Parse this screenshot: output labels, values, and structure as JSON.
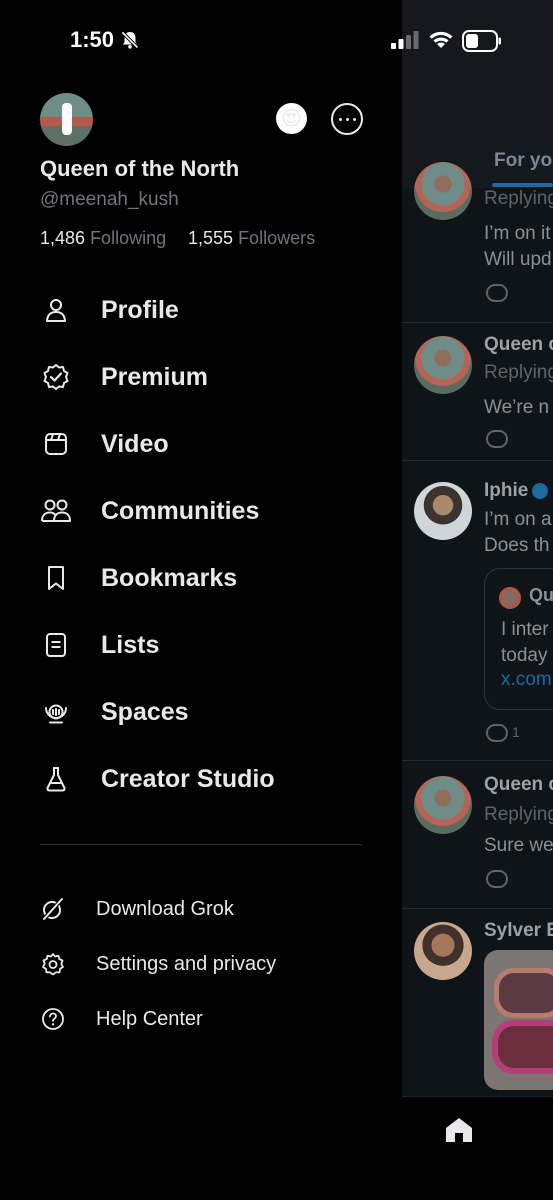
{
  "status_bar": {
    "time": "1:50",
    "icons": [
      "bell-slash-icon",
      "signal-icon",
      "wifi-icon",
      "battery-icon"
    ]
  },
  "profile": {
    "display_name": "Queen of the North",
    "handle": "@meenah_kush",
    "following_count": "1,486",
    "following_label": "Following",
    "followers_count": "1,555",
    "followers_label": "Followers",
    "emoji": "😍"
  },
  "menu": [
    {
      "label": "Profile",
      "icon": "person-icon"
    },
    {
      "label": "Premium",
      "icon": "verified-badge-icon"
    },
    {
      "label": "Video",
      "icon": "video-icon"
    },
    {
      "label": "Communities",
      "icon": "communities-icon"
    },
    {
      "label": "Bookmarks",
      "icon": "bookmark-icon"
    },
    {
      "label": "Lists",
      "icon": "list-icon"
    },
    {
      "label": "Spaces",
      "icon": "spaces-icon"
    },
    {
      "label": "Creator Studio",
      "icon": "flask-icon"
    }
  ],
  "secondary_menu": [
    {
      "label": "Download Grok",
      "icon": "grok-icon"
    },
    {
      "label": "Settings and privacy",
      "icon": "gear-icon"
    },
    {
      "label": "Help Center",
      "icon": "help-icon"
    }
  ],
  "timeline": {
    "tab": "For yo",
    "posts": [
      {
        "name": "",
        "sub": "Replying",
        "lines": [
          "I’m on it",
          "Will upd"
        ]
      },
      {
        "name": "Queen c",
        "sub": "Replying",
        "lines": [
          "We’re n"
        ]
      },
      {
        "name": "Iphie",
        "sub": "",
        "lines": [
          "I’m on a",
          "Does th"
        ],
        "quote_name": "Qu",
        "quote_lines": [
          "I inter",
          "today"
        ],
        "quote_link": "x.com",
        "reply_count": "1"
      },
      {
        "name": "Queen c",
        "sub": "Replying",
        "lines": [
          "Sure we"
        ]
      },
      {
        "name": "Sylver E",
        "sub": "",
        "lines": []
      }
    ]
  },
  "colors": {
    "background": "#000000",
    "text": "#e7e9ea",
    "muted": "#71767b",
    "accent": "#1d9bf0"
  }
}
